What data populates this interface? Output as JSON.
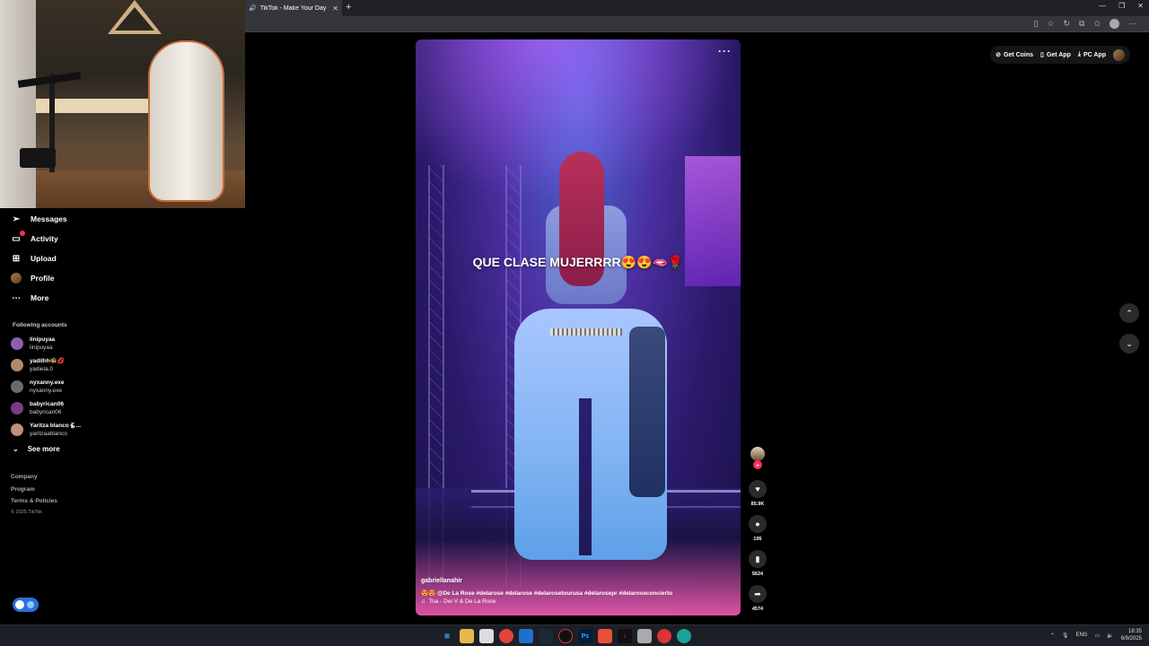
{
  "browser": {
    "tab_title": "TikTok - Make Your Day",
    "tab_close": "✕",
    "new_tab": "+",
    "window_controls": [
      "—",
      "❐",
      "✕"
    ]
  },
  "sidebar": {
    "nav": [
      {
        "label": "Messages",
        "icon": "messages-icon"
      },
      {
        "label": "Activity",
        "icon": "activity-icon"
      },
      {
        "label": "Upload",
        "icon": "upload-icon"
      },
      {
        "label": "Profile",
        "icon": "profile-avatar"
      },
      {
        "label": "More",
        "icon": "more-icon"
      }
    ],
    "following_title": "Following accounts",
    "accounts": [
      {
        "name": "linipuyaa",
        "handle": "linipuyaa",
        "color": "#8a5fb0"
      },
      {
        "name": "yadilhh🐝💋",
        "handle": "yadiela.0",
        "color": "#b08a6a"
      },
      {
        "name": "nyxanny.exe",
        "handle": "nyxanny.exe",
        "color": "#6a6a6a"
      },
      {
        "name": "babyrican06",
        "handle": "babyrican06",
        "color": "#7a3a8a"
      },
      {
        "name": "Yaritza blanco🐇...",
        "handle": "yaritzaablanco",
        "color": "#c0907a"
      }
    ],
    "see_more": "See more",
    "footer": {
      "company": "Company",
      "program": "Program",
      "terms": "Terms & Policies",
      "copyright": "© 2025 TikTok"
    }
  },
  "header": {
    "get_coins": "Get Coins",
    "get_app": "Get App",
    "pc_app": "PC App"
  },
  "video": {
    "caption": "QUE CLASE MUJERRRR😍😍🫦🌹",
    "username": "gabriellanahir",
    "description": "😍😍 @De La Rose  #delarose #delarose   #delarosetourusa #delarosepr #delaroseconcierto",
    "music": "Toa - Dei V & De La Rose",
    "more": "···"
  },
  "actions": {
    "likes": "85.9K",
    "comments": "195",
    "saves": "5624",
    "shares": "4574"
  },
  "taskbar": {
    "lang": "ENG",
    "time": "18:35",
    "date": "6/9/2025"
  },
  "colors": {
    "accent": "#fe2c55",
    "background": "#000000"
  }
}
